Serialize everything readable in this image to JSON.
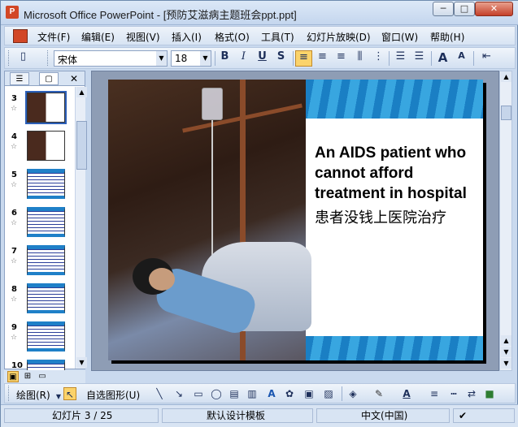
{
  "window": {
    "title": "Microsoft Office PowerPoint - [预防艾滋病主题班会ppt.ppt]",
    "app_icon_glyph": "P",
    "buttons": {
      "minimize": "─",
      "maximize": "□",
      "close": "✕"
    }
  },
  "menubar": {
    "items": [
      "文件(F)",
      "编辑(E)",
      "视图(V)",
      "插入(I)",
      "格式(O)",
      "工具(T)",
      "幻灯片放映(D)",
      "窗口(W)",
      "帮助(H)"
    ]
  },
  "toolbar": {
    "font_name": "宋体",
    "font_size": "18",
    "bold": "B",
    "italic": "I",
    "underline": "U",
    "shadow": "S",
    "align_left": "≡",
    "align_center": "≡",
    "align_right": "≡",
    "increase_font": "A",
    "decrease_font": "A"
  },
  "slides_pane": {
    "tab_outline": "☰",
    "tab_slides": "▢",
    "close": "✕",
    "thumbnails": [
      {
        "num": "3",
        "star": "☆",
        "selected": true,
        "style": "dark"
      },
      {
        "num": "4",
        "star": "☆",
        "selected": false,
        "style": "dark"
      },
      {
        "num": "5",
        "star": "☆",
        "selected": false,
        "style": "light"
      },
      {
        "num": "6",
        "star": "☆",
        "selected": false,
        "style": "light"
      },
      {
        "num": "7",
        "star": "☆",
        "selected": false,
        "style": "light"
      },
      {
        "num": "8",
        "star": "☆",
        "selected": false,
        "style": "light"
      },
      {
        "num": "9",
        "star": "☆",
        "selected": false,
        "style": "light"
      },
      {
        "num": "10",
        "star": "☆",
        "selected": false,
        "style": "light"
      }
    ]
  },
  "slide": {
    "text_en": "An AIDS patient who cannot afford treatment in hospital",
    "text_cn": "患者没钱上医院治疗"
  },
  "drawbar": {
    "draw_label": "绘图(R)",
    "autoshapes_label": "自选图形(U)"
  },
  "statusbar": {
    "slide_info": "幻灯片 3 / 25",
    "template": "默认设计模板",
    "language": "中文(中国)"
  }
}
